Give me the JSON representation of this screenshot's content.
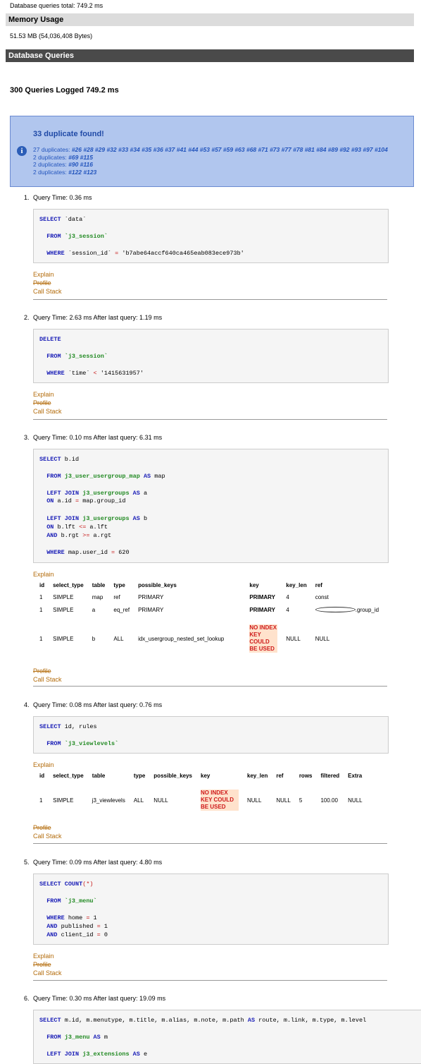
{
  "header": {
    "db_total": "Database queries total: 749.2 ms",
    "memory_title": "Memory Usage",
    "memory_value": "51.53 MB (54,036,408 Bytes)",
    "db_title": "Database Queries",
    "logged": "300 Queries Logged 749.2 ms"
  },
  "duplicates": {
    "title": "33 duplicate found!",
    "icon": "info-icon",
    "lines": [
      {
        "label": "27 duplicates:",
        "ids": "#26 #28 #29 #32 #33 #34 #35 #36 #37 #41 #44 #53 #57 #59 #63 #68 #71 #73 #77 #78 #81 #84 #89 #92 #93 #97 #104"
      },
      {
        "label": "2 duplicates:",
        "ids": "#69 #115"
      },
      {
        "label": "2 duplicates:",
        "ids": "#90 #116"
      },
      {
        "label": "2 duplicates:",
        "ids": "#122 #123"
      }
    ]
  },
  "links": {
    "explain": "Explain",
    "profile": "Profile",
    "callstack": "Call Stack"
  },
  "queries": [
    {
      "num": "1.",
      "time": "Query Time: 0.36 ms"
    },
    {
      "num": "2.",
      "time": "Query Time: 2.63 ms After last query: 1.19 ms"
    },
    {
      "num": "3.",
      "time": "Query Time: 0.10 ms After last query: 6.31 ms"
    },
    {
      "num": "4.",
      "time": "Query Time: 0.08 ms After last query: 0.76 ms"
    },
    {
      "num": "5.",
      "time": "Query Time: 0.09 ms After last query: 4.80 ms"
    },
    {
      "num": "6.",
      "time": "Query Time: 0.30 ms After last query: 19.09 ms"
    }
  ],
  "sql": {
    "q1": {
      "l1a": "SELECT",
      "l1b": " `data`",
      "l2a": "FROM",
      "l2b": "`j3_session`",
      "l3a": "WHERE",
      "l3b": " `session_id` ",
      "l3c": "=",
      "l3d": " 'b7abe64accf640ca465eab083ece973b'"
    },
    "q2": {
      "l1a": "DELETE",
      "l2a": "FROM",
      "l2b": "`j3_session`",
      "l3a": "WHERE",
      "l3b": " `time` ",
      "l3c": "<",
      "l3d": " '1415631957'"
    },
    "q3": {
      "l1a": "SELECT",
      "l1b": " b.id",
      "l2a": "FROM",
      "l2b": "j3_user_usergroup_map",
      "l2c": "AS",
      "l2d": " map",
      "l3a": "LEFT JOIN",
      "l3b": "j3_usergroups",
      "l3c": "AS",
      "l3d": " a",
      "l4a": "ON",
      "l4b": " a.id ",
      "l4c": "=",
      "l4d": " map.group_id",
      "l5a": "LEFT JOIN",
      "l5b": "j3_usergroups",
      "l5c": "AS",
      "l5d": " b",
      "l6a": "ON",
      "l6b": " b.lft ",
      "l6c": "<=",
      "l6d": " a.lft",
      "l7a": "AND",
      "l7b": " b.rgt ",
      "l7c": ">=",
      "l7d": " a.rgt",
      "l8a": "WHERE",
      "l8b": " map.user_id ",
      "l8c": "=",
      "l8d": " 620"
    },
    "q4": {
      "l1a": "SELECT",
      "l1b": " id, rules",
      "l2a": "FROM",
      "l2b": "`j3_viewlevels`"
    },
    "q5": {
      "l1a": "SELECT",
      "l1b": "COUNT",
      "l1c": "(*)",
      "l2a": "FROM",
      "l2b": "`j3_menu`",
      "l3a": "WHERE",
      "l3b": " home ",
      "l3c": "=",
      "l3d": " 1",
      "l4a": "AND",
      "l4b": " published ",
      "l4c": "=",
      "l4d": " 1",
      "l5a": "AND",
      "l5b": " client_id ",
      "l5c": "=",
      "l5d": " 0"
    },
    "q6": {
      "l1a": "SELECT",
      "l1b": " m.id, m.menutype, m.title, m.alias, m.note, m.path ",
      "l1c": "AS",
      "l1d": " route, m.link, m.type, m.level",
      "l2a": "FROM",
      "l2b": "j3_menu",
      "l2c": "AS",
      "l2d": " m",
      "l3a": "LEFT JOIN",
      "l3b": "j3_extensions",
      "l3c": "AS",
      "l3d": " e"
    }
  },
  "explain3": {
    "headers": [
      "id",
      "select_type",
      "table",
      "type",
      "possible_keys",
      "key",
      "key_len",
      "ref"
    ],
    "rows": [
      [
        "1",
        "SIMPLE",
        "map",
        "ref",
        "PRIMARY",
        "PRIMARY",
        "4",
        "const"
      ],
      [
        "1",
        "SIMPLE",
        "a",
        "eq_ref",
        "PRIMARY",
        "PRIMARY",
        "4",
        ".group_id"
      ],
      [
        "1",
        "SIMPLE",
        "b",
        "ALL",
        "idx_usergroup_nested_set_lookup",
        "NO INDEX KEY COULD BE USED",
        "NULL",
        "NULL"
      ]
    ]
  },
  "explain4": {
    "headers": [
      "id",
      "select_type",
      "table",
      "type",
      "possible_keys",
      "key",
      "key_len",
      "ref",
      "rows",
      "filtered",
      "Extra"
    ],
    "row": [
      "1",
      "SIMPLE",
      "j3_viewlevels",
      "ALL",
      "NULL",
      "NO INDEX KEY COULD BE USED",
      "NULL",
      "NULL",
      "5",
      "100.00",
      "NULL"
    ]
  }
}
